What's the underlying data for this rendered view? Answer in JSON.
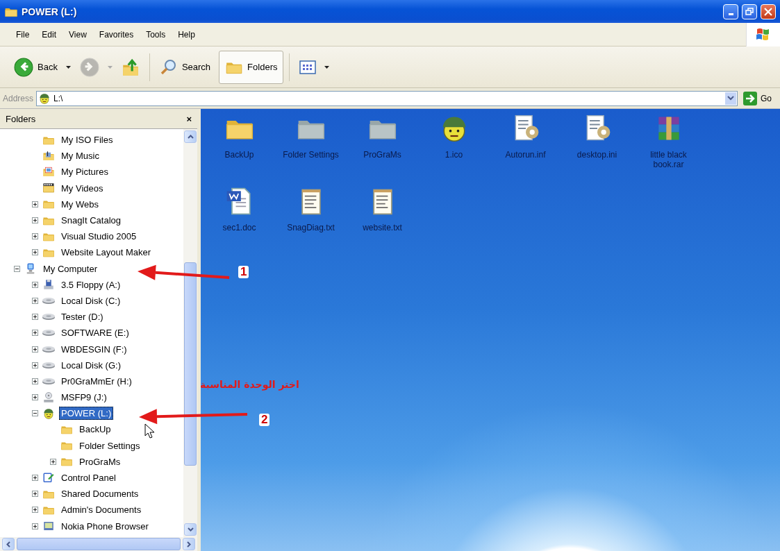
{
  "window": {
    "title": "POWER (L:)"
  },
  "menu": [
    "File",
    "Edit",
    "View",
    "Favorites",
    "Tools",
    "Help"
  ],
  "toolbar": [
    {
      "kind": "back",
      "label": "Back",
      "disabled": false,
      "pressed": false
    },
    {
      "kind": "forward",
      "disabled": true,
      "pressed": false
    },
    {
      "kind": "up",
      "disabled": false,
      "pressed": false
    },
    {
      "kind": "search",
      "label": "Search",
      "disabled": false,
      "pressed": false
    },
    {
      "kind": "folders",
      "label": "Folders",
      "disabled": false,
      "pressed": true
    },
    {
      "kind": "views",
      "disabled": false,
      "pressed": false
    }
  ],
  "address": {
    "label": "Address",
    "value": "L:\\",
    "go": "Go"
  },
  "folders_pane": {
    "title": "Folders",
    "close": "×"
  },
  "tree": [
    {
      "children": [
        {
          "label": "My ISO Files",
          "kind": "folder",
          "selected": false
        },
        {
          "label": "My Music",
          "kind": "music",
          "selected": false
        },
        {
          "label": "My Pictures",
          "kind": "pictures",
          "selected": false
        },
        {
          "label": "My Videos",
          "kind": "videos",
          "selected": false
        },
        {
          "label": "My Webs",
          "kind": "folder",
          "expanded": false,
          "selected": false
        },
        {
          "label": "SnagIt Catalog",
          "kind": "folder",
          "expanded": false,
          "selected": false
        },
        {
          "label": "Visual Studio 2005",
          "kind": "folder",
          "expanded": false,
          "selected": false
        },
        {
          "label": "Website Layout Maker",
          "kind": "folder",
          "expanded": false,
          "selected": false
        }
      ]
    },
    {
      "label": "My Computer",
      "kind": "computer",
      "expanded": true,
      "selected": false,
      "children": [
        {
          "label": "3.5 Floppy (A:)",
          "kind": "floppy",
          "expanded": false,
          "selected": false
        },
        {
          "label": "Local Disk (C:)",
          "kind": "disk",
          "expanded": false,
          "selected": false
        },
        {
          "label": "Tester (D:)",
          "kind": "disk",
          "expanded": false,
          "selected": false
        },
        {
          "label": "SOFTWARE (E:)",
          "kind": "disk",
          "expanded": false,
          "selected": false
        },
        {
          "label": "WBDESGIN (F:)",
          "kind": "disk",
          "expanded": false,
          "selected": false
        },
        {
          "label": "Local Disk (G:)",
          "kind": "disk",
          "expanded": false,
          "selected": false
        },
        {
          "label": "Pr0GraMmEr (H:)",
          "kind": "disk",
          "expanded": false,
          "selected": false
        },
        {
          "label": "MSFP9 (J:)",
          "kind": "cd",
          "expanded": false,
          "selected": false
        },
        {
          "label": "POWER (L:)",
          "kind": "face",
          "expanded": true,
          "selected": true,
          "children": [
            {
              "label": "BackUp",
              "kind": "folder",
              "selected": false
            },
            {
              "label": "Folder Settings",
              "kind": "folder",
              "selected": false
            },
            {
              "label": "ProGraMs",
              "kind": "folder",
              "expanded": false,
              "selected": false
            }
          ]
        },
        {
          "label": "Control Panel",
          "kind": "control-panel",
          "expanded": false,
          "selected": false
        },
        {
          "label": "Shared Documents",
          "kind": "folder",
          "expanded": false,
          "selected": false
        },
        {
          "label": "Admin's Documents",
          "kind": "folder",
          "expanded": false,
          "selected": false
        },
        {
          "label": "Nokia Phone Browser",
          "kind": "phone",
          "expanded": false,
          "selected": false
        }
      ]
    }
  ],
  "files": [
    {
      "name": "BackUp",
      "kind": "folder"
    },
    {
      "name": "Folder Settings",
      "kind": "hidden-folder"
    },
    {
      "name": "ProGraMs",
      "kind": "hidden-folder"
    },
    {
      "name": "1.ico",
      "kind": "face"
    },
    {
      "name": "Autorun.inf",
      "kind": "settings"
    },
    {
      "name": "desktop.ini",
      "kind": "settings"
    },
    {
      "name": "little black book.rar",
      "kind": "archive"
    },
    {
      "name": "sec1.doc",
      "kind": "word"
    },
    {
      "name": "SnagDiag.txt",
      "kind": "text"
    },
    {
      "name": "website.txt",
      "kind": "text"
    }
  ],
  "annotations": {
    "arrows": [
      {
        "number": "1"
      },
      {
        "number": "2"
      }
    ],
    "caption": "اختر الوحدة المناسبة"
  }
}
